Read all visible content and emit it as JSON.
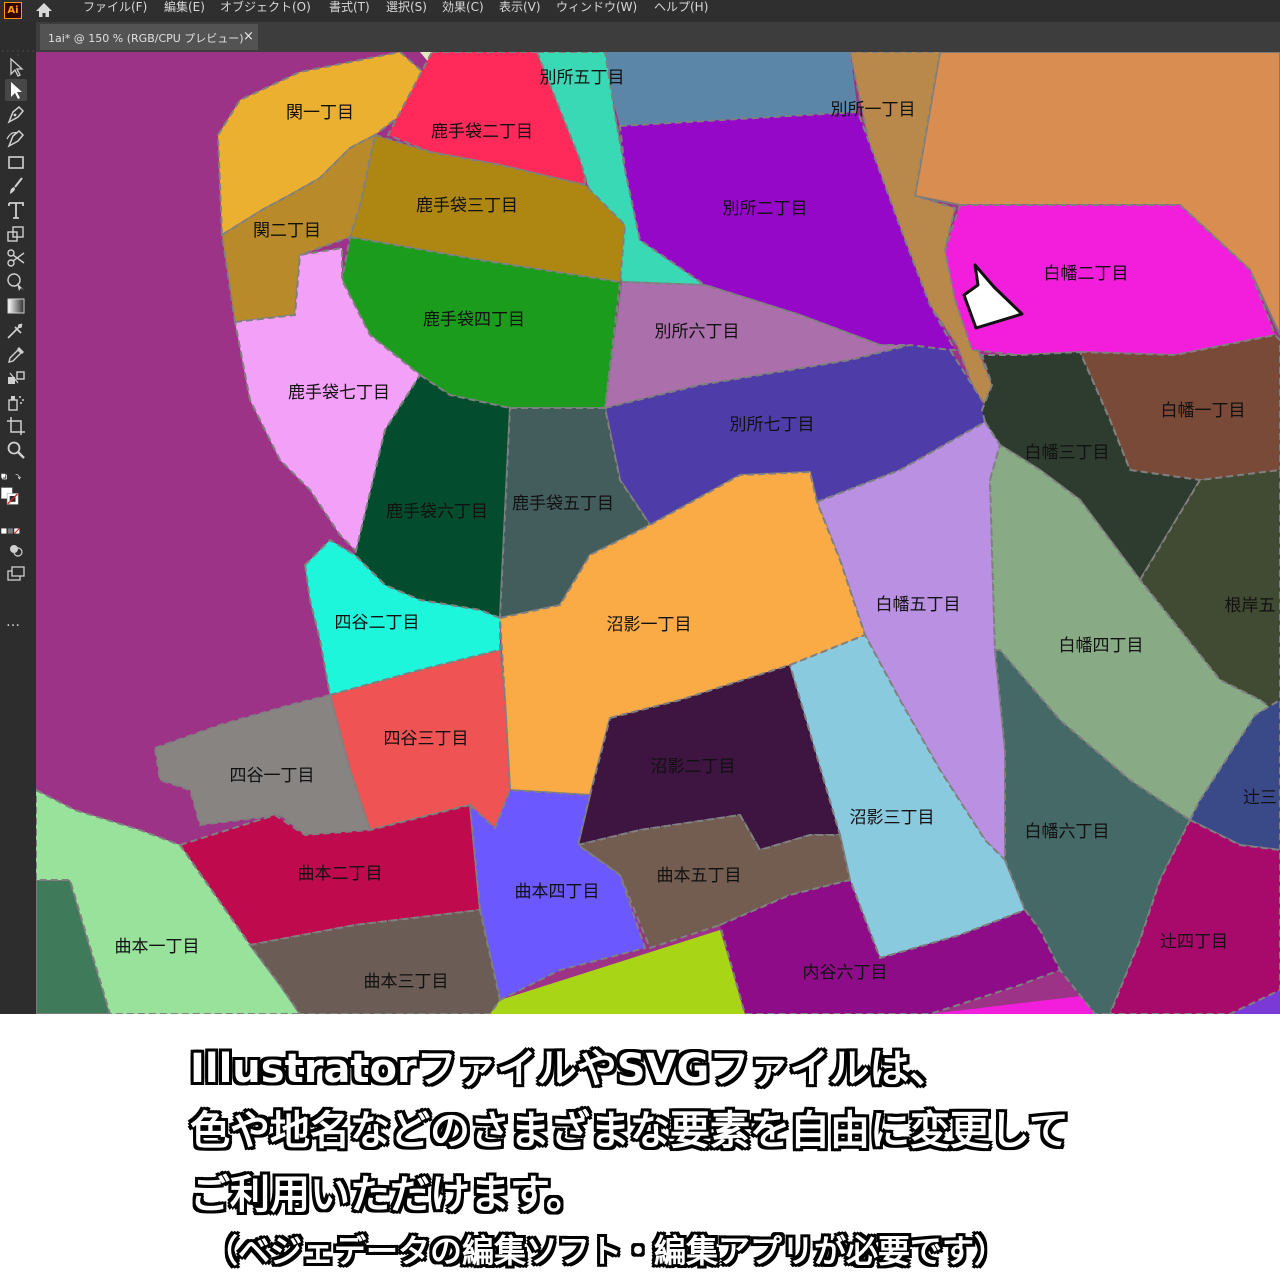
{
  "app": {
    "logo_text": "Ai"
  },
  "menu": [
    "ファイル(F)",
    "編集(E)",
    "オブジェクト(O)",
    "書式(T)",
    "選択(S)",
    "効果(C)",
    "表示(V)",
    "ウィンドウ(W)",
    "ヘルプ(H)"
  ],
  "document_tab": {
    "label": "1ai* @ 150 % (RGB/CPU プレビュー)",
    "close": "×"
  },
  "tools": [
    {
      "name": "selection-tool-icon"
    },
    {
      "name": "direct-selection-tool-icon"
    },
    {
      "name": "pen-tool-icon"
    },
    {
      "name": "curvature-tool-icon"
    },
    {
      "name": "rectangle-tool-icon"
    },
    {
      "name": "paintbrush-tool-icon"
    },
    {
      "name": "type-tool-icon"
    },
    {
      "name": "scale-tool-icon"
    },
    {
      "name": "scissors-tool-icon"
    },
    {
      "name": "shape-builder-tool-icon"
    },
    {
      "name": "gradient-tool-icon"
    },
    {
      "name": "mesh-tool-icon"
    },
    {
      "name": "eyedropper-tool-icon"
    },
    {
      "name": "blend-tool-icon"
    },
    {
      "name": "symbol-sprayer-tool-icon"
    },
    {
      "name": "artboard-tool-icon"
    },
    {
      "name": "zoom-tool-icon"
    }
  ],
  "tool_more": "…",
  "districts": [
    {
      "label": "関一丁目",
      "color": "#ecb030"
    },
    {
      "label": "鹿手袋二丁目",
      "color": "#ff2a5a"
    },
    {
      "label": "別所五丁目",
      "color": "#3ad9b6"
    },
    {
      "label": "別所一丁目",
      "color": "#b8894a"
    },
    {
      "label": "鹿手袋三丁目",
      "color": "#ad8712"
    },
    {
      "label": "関二丁目",
      "color": "#b88a2a"
    },
    {
      "label": "別所二丁目",
      "color": "#9608c8"
    },
    {
      "label": "白幡二丁目",
      "color": "#f31ddc"
    },
    {
      "label": "鹿手袋四丁目",
      "color": "#1c9c1c"
    },
    {
      "label": "別所六丁目",
      "color": "#ab70ab"
    },
    {
      "label": "鹿手袋七丁目",
      "color": "#f2a0f8"
    },
    {
      "label": "白幡一丁目",
      "color": "#7a4a38"
    },
    {
      "label": "別所七丁目",
      "color": "#4e3ca8"
    },
    {
      "label": "白幡三丁目",
      "color": "#2e3c30"
    },
    {
      "label": "鹿手袋六丁目",
      "color": "#034d2e"
    },
    {
      "label": "鹿手袋五丁目",
      "color": "#435c5c"
    },
    {
      "label": "白幡五丁目",
      "color": "#b990e2"
    },
    {
      "label": "根岸五",
      "color": "#414a32"
    },
    {
      "label": "白幡四丁目",
      "color": "#88ab86"
    },
    {
      "label": "四谷二丁目",
      "color": "#1ef6dc"
    },
    {
      "label": "沼影一丁目",
      "color": "#fbab45"
    },
    {
      "label": "四谷三丁目",
      "color": "#ef5353"
    },
    {
      "label": "四谷一丁目",
      "color": "#878482"
    },
    {
      "label": "沼影二丁目",
      "color": "#3e1441"
    },
    {
      "label": "辻三",
      "color": "#3a4a88"
    },
    {
      "label": "沼影三丁目",
      "color": "#8acade"
    },
    {
      "label": "白幡六丁目",
      "color": "#446966"
    },
    {
      "label": "曲本二丁目",
      "color": "#bf0b4d"
    },
    {
      "label": "曲本五丁目",
      "color": "#725d50"
    },
    {
      "label": "曲本四丁目",
      "color": "#6b59ff"
    },
    {
      "label": "辻四丁目",
      "color": "#a80a6c"
    },
    {
      "label": "曲本一丁目",
      "color": "#98e29c"
    },
    {
      "label": "内谷六丁目",
      "color": "#8e0c87"
    },
    {
      "label": "曲本三丁目",
      "color": "#6b5c55"
    }
  ],
  "map_colors": {
    "base_purple": "#9d3386",
    "dark_green": "#3f7b5b",
    "top_left_purple": "#9d3386",
    "steel_blue": "#5b86a8",
    "orange": "#d98d51",
    "lime": "#a8d616",
    "magenta_bottom": "#f31ddc",
    "violet_corner": "#7b3ad8"
  },
  "caption": {
    "line1": "IllustratorファイルやSVGファイルは、",
    "line2": "色や地名などのさまざまな要素を自由に変更して",
    "line3": "ご利用いただけます。",
    "note": "（ベジェデータの編集ソフト・編集アプリが必要です）"
  }
}
